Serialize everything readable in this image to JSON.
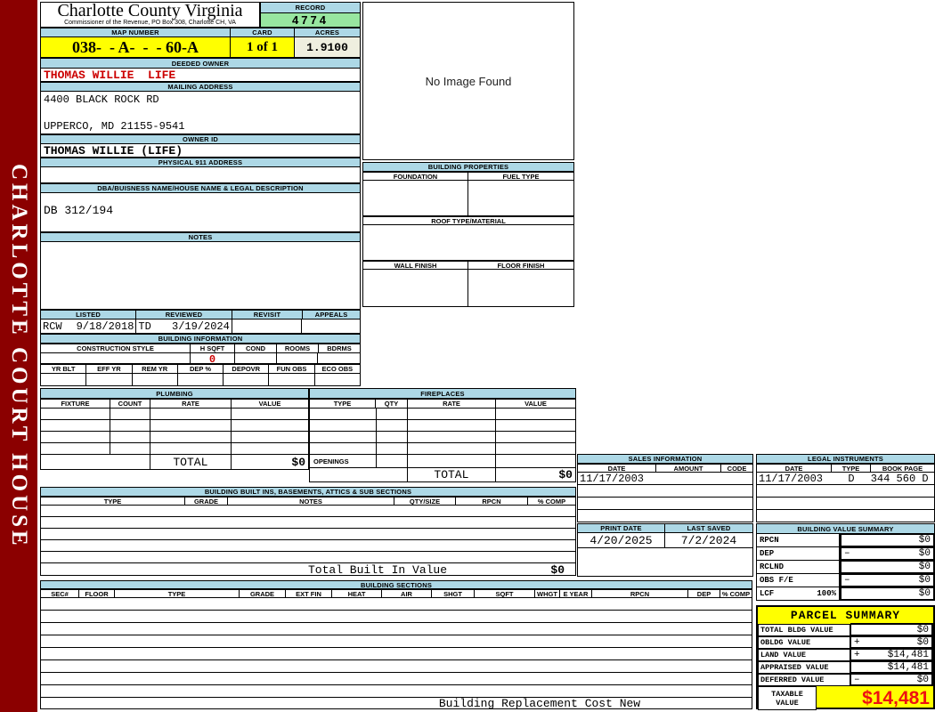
{
  "sidebar": {
    "title": "CHARLOTTE COURT HOUSE"
  },
  "header": {
    "county_title": "Charlotte County Virginia",
    "commissioner_line": "Commissioner of the Revenue, PO Box 308, Charlotte CH, VA",
    "record_label": "RECORD",
    "record_value": "4774",
    "map_number_label": "MAP NUMBER",
    "map_number_value": "038-  - A-  -  - 60-A",
    "card_label": "CARD",
    "card_value": "1 of 1",
    "acres_label": "ACRES",
    "acres_value": "1.9100"
  },
  "owner": {
    "deeded_owner_label": "DEEDED OWNER",
    "deeded_owner_value": "THOMAS WILLIE  LIFE",
    "mailing_address_label": "MAILING ADDRESS",
    "mailing_address_line1": "4400 BLACK ROCK RD",
    "mailing_address_line2": "UPPERCO, MD 21155-9541",
    "owner_id_label": "OWNER ID",
    "owner_id_value": "THOMAS WILLIE (LIFE)",
    "physical_address_label": "PHYSICAL 911 ADDRESS",
    "physical_address_value": ""
  },
  "description": {
    "dba_label": "DBA/BUISNESS NAME/HOUSE NAME & LEGAL DESCRIPTION",
    "dba_value": "DB 312/194",
    "notes_label": "NOTES",
    "notes_value": ""
  },
  "review": {
    "listed_label": "LISTED",
    "listed_by": "RCW",
    "listed_date": "9/18/2018",
    "reviewed_label": "REVIEWED",
    "reviewed_by": "TD",
    "reviewed_date": "3/19/2024",
    "revisit_label": "REVISIT",
    "revisit_value": "",
    "appeals_label": "APPEALS",
    "appeals_value": ""
  },
  "building_info": {
    "title": "BUILDING INFORMATION",
    "row1_headers": [
      "CONSTRUCTION STYLE",
      "H SQFT",
      "COND",
      "ROOMS",
      "BDRMS"
    ],
    "h_sqft_value": "0",
    "row2_headers": [
      "YR BLT",
      "EFF YR",
      "REM YR",
      "DEP %",
      "DEPOVR",
      "FUN OBS",
      "ECO OBS"
    ]
  },
  "plumbing": {
    "title": "PLUMBING",
    "headers": [
      "FIXTURE",
      "COUNT",
      "RATE",
      "VALUE"
    ],
    "total_label": "TOTAL",
    "total_value": "$0"
  },
  "fireplaces": {
    "title": "FIREPLACES",
    "headers": [
      "TYPE",
      "QTY",
      "RATE",
      "VALUE"
    ],
    "openings_label": "OPENINGS",
    "total_label": "TOTAL",
    "total_value": "$0"
  },
  "built_ins": {
    "title": "BUILDING BUILT INS, BASEMENTS, ATTICS & SUB SECTIONS",
    "headers": [
      "TYPE",
      "GRADE",
      "NOTES",
      "QTY/SIZE",
      "RPCN",
      "% COMP"
    ],
    "total_label": "Total Built In Value",
    "total_value": "$0"
  },
  "building_sections": {
    "title": "BUILDING SECTIONS",
    "headers": [
      "SEC#",
      "FLOOR",
      "TYPE",
      "GRADE",
      "EXT FIN",
      "HEAT",
      "AIR",
      "SHGT",
      "SQFT",
      "WHGT",
      "E YEAR",
      "RPCN",
      "DEP",
      "% COMP"
    ],
    "footer_label": "Building Replacement Cost New"
  },
  "image_panel": {
    "message": "No Image Found"
  },
  "building_properties": {
    "title": "BUILDING PROPERTIES",
    "foundation_label": "FOUNDATION",
    "fuel_type_label": "FUEL TYPE",
    "roof_label": "ROOF TYPE/MATERIAL",
    "wall_finish_label": "WALL FINISH",
    "floor_finish_label": "FLOOR FINISH"
  },
  "sales": {
    "title": "SALES INFORMATION",
    "headers": [
      "DATE",
      "AMOUNT",
      "CODE"
    ],
    "rows": [
      {
        "date": "11/17/2003",
        "amount": "",
        "code": ""
      }
    ]
  },
  "legal_instruments": {
    "title": "LEGAL INSTRUMENTS",
    "headers": [
      "DATE",
      "TYPE",
      "BOOK PAGE"
    ],
    "rows": [
      {
        "date": "11/17/2003",
        "type": "D",
        "book_page": "344 560 D"
      }
    ]
  },
  "dates": {
    "print_date_label": "PRINT DATE",
    "print_date_value": "4/20/2025",
    "last_saved_label": "LAST SAVED",
    "last_saved_value": "7/2/2024"
  },
  "building_value_summary": {
    "title": "BUILDING VALUE SUMMARY",
    "rows": [
      {
        "label": "RPCN",
        "pct": "",
        "sign": "",
        "value": "$0"
      },
      {
        "label": "DEP",
        "pct": "",
        "sign": "–",
        "value": "$0"
      },
      {
        "label": "RCLND",
        "pct": "",
        "sign": "",
        "value": "$0"
      },
      {
        "label": "OBS F/E",
        "pct": "",
        "sign": "–",
        "value": "$0"
      },
      {
        "label": "LCF",
        "pct": "100%",
        "sign": "",
        "value": "$0"
      }
    ]
  },
  "parcel_summary": {
    "title": "PARCEL SUMMARY",
    "rows": [
      {
        "label": "TOTAL BLDG VALUE",
        "sign": "",
        "value": "$0"
      },
      {
        "label": "OBLDG VALUE",
        "sign": "+",
        "value": "$0"
      },
      {
        "label": "LAND VALUE",
        "sign": "+",
        "value": "$14,481"
      },
      {
        "label": "APPRAISED VALUE",
        "sign": "",
        "value": "$14,481"
      },
      {
        "label": "DEFERRED VALUE",
        "sign": "–",
        "value": "$0"
      }
    ],
    "taxable_label": "TAXABLE VALUE",
    "taxable_value": "$14,481"
  },
  "colors": {
    "sidebar_maroon": "#8B0000",
    "header_blue": "#ADD8E6",
    "record_green": "#98E6A0",
    "highlight_yellow": "#FFFF00",
    "acres_cream": "#EFEFDF",
    "owner_red": "#CC0000",
    "taxable_red": "#EE1111",
    "alt_row": "#F2F4FB"
  }
}
